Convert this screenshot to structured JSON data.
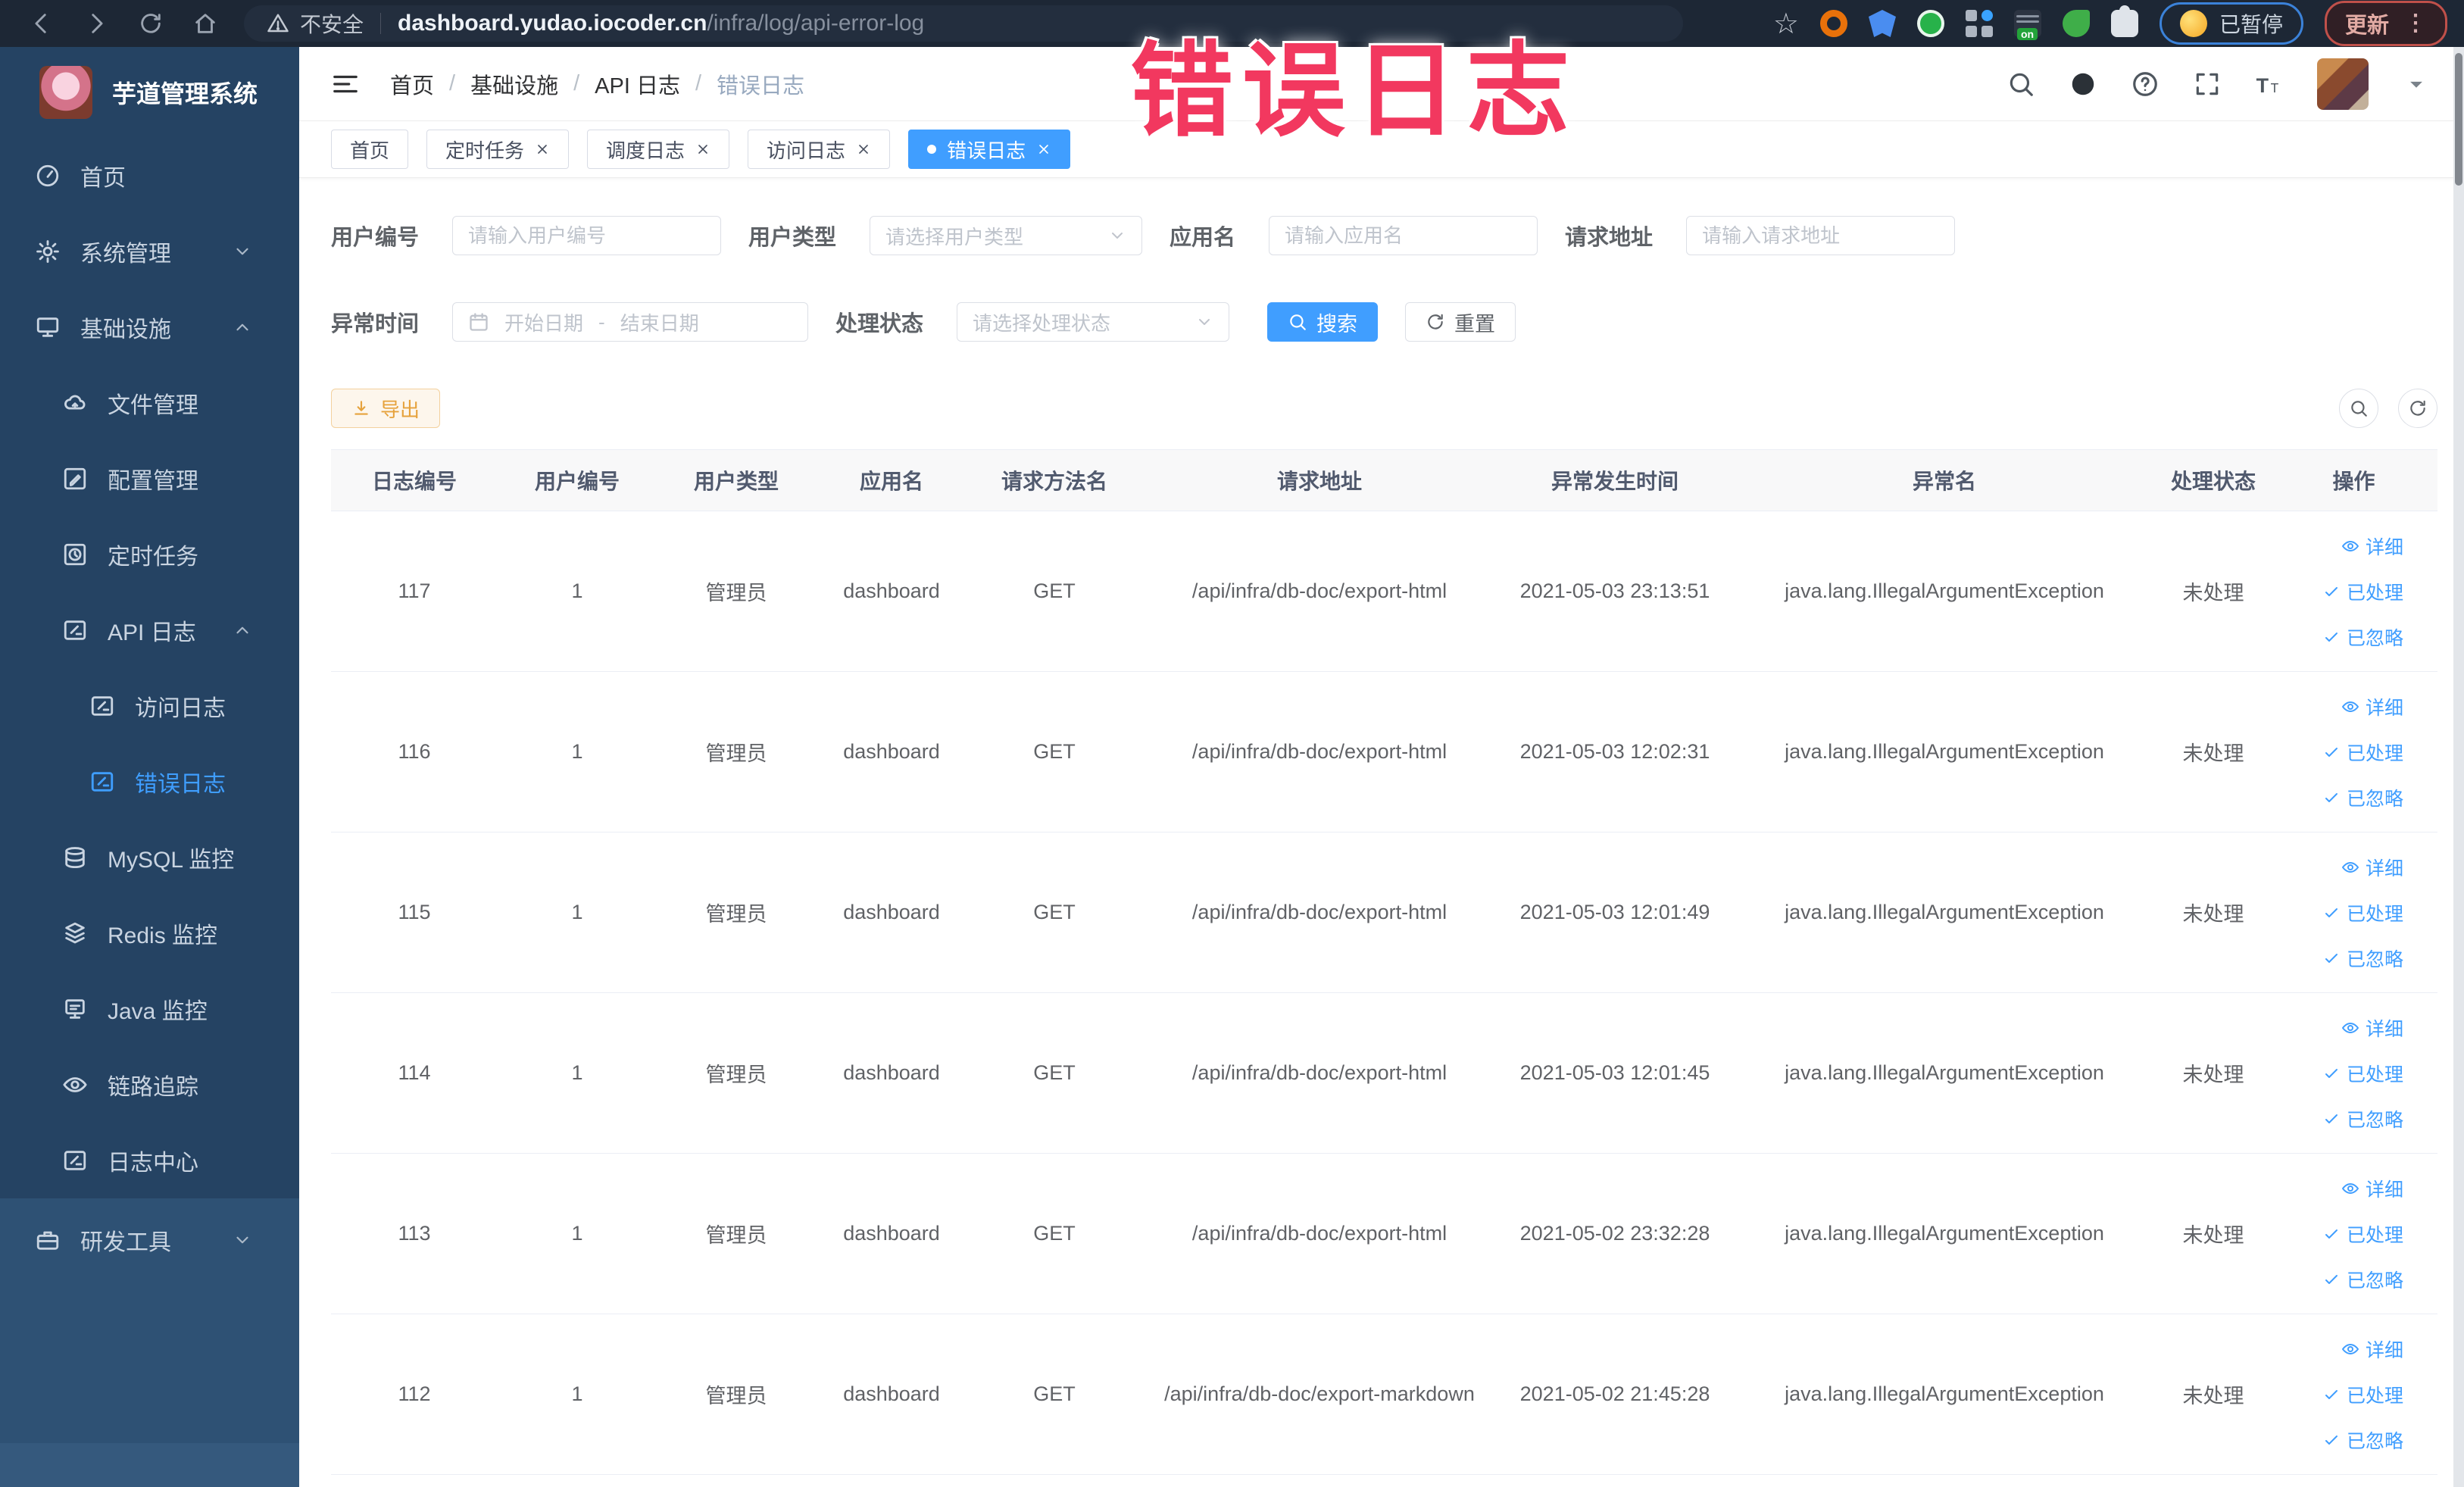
{
  "browser": {
    "security_label": "不安全",
    "url_domain": "dashboard.yudao.iocoder.cn",
    "url_path": "/infra/log/api-error-log",
    "paused_badge": "已暂停",
    "update_button": "更新"
  },
  "overlay": {
    "title": "错误日志"
  },
  "sidebar": {
    "logo_title": "芋道管理系统",
    "items": [
      {
        "id": "home",
        "label": "首页",
        "icon": "gauge",
        "level": 1
      },
      {
        "id": "system",
        "label": "系统管理",
        "icon": "gear",
        "level": 1,
        "chevron": "down"
      },
      {
        "id": "infra",
        "label": "基础设施",
        "icon": "monitor",
        "level": 1,
        "chevron": "up"
      },
      {
        "id": "file",
        "label": "文件管理",
        "icon": "cloud",
        "level": 2
      },
      {
        "id": "config",
        "label": "配置管理",
        "icon": "edit",
        "level": 2
      },
      {
        "id": "job",
        "label": "定时任务",
        "icon": "job",
        "level": 2
      },
      {
        "id": "api-log",
        "label": "API 日志",
        "icon": "logedit",
        "level": 2,
        "chevron": "up"
      },
      {
        "id": "access-log",
        "label": "访问日志",
        "icon": "logedit",
        "level": 3
      },
      {
        "id": "error-log",
        "label": "错误日志",
        "icon": "logedit",
        "level": 3,
        "active": true
      },
      {
        "id": "mysql",
        "label": "MySQL 监控",
        "icon": "mysql",
        "level": 2
      },
      {
        "id": "redis",
        "label": "Redis 监控",
        "icon": "redis",
        "level": 2
      },
      {
        "id": "java",
        "label": "Java 监控",
        "icon": "java",
        "level": 2
      },
      {
        "id": "trace",
        "label": "链路追踪",
        "icon": "eye",
        "level": 2
      },
      {
        "id": "log-center",
        "label": "日志中心",
        "icon": "logedit",
        "level": 2
      },
      {
        "id": "dev-tools",
        "label": "研发工具",
        "icon": "tools",
        "level": 1,
        "chevron": "down",
        "section": "light"
      }
    ]
  },
  "header": {
    "breadcrumb": [
      "首页",
      "基础设施",
      "API 日志",
      "错误日志"
    ]
  },
  "tabs": [
    {
      "label": "首页",
      "closable": false,
      "active": false
    },
    {
      "label": "定时任务",
      "closable": true,
      "active": false
    },
    {
      "label": "调度日志",
      "closable": true,
      "active": false
    },
    {
      "label": "访问日志",
      "closable": true,
      "active": false
    },
    {
      "label": "错误日志",
      "closable": true,
      "active": true
    }
  ],
  "filters": {
    "user_id": {
      "label": "用户编号",
      "placeholder": "请输入用户编号"
    },
    "user_type": {
      "label": "用户类型",
      "placeholder": "请选择用户类型"
    },
    "app_name": {
      "label": "应用名",
      "placeholder": "请输入应用名"
    },
    "request_url": {
      "label": "请求地址",
      "placeholder": "请输入请求地址"
    },
    "exception_time": {
      "label": "异常时间",
      "start_placeholder": "开始日期",
      "separator": "-",
      "end_placeholder": "结束日期"
    },
    "process_status": {
      "label": "处理状态",
      "placeholder": "请选择处理状态"
    },
    "search_button": "搜索",
    "reset_button": "重置"
  },
  "toolbar": {
    "export_button": "导出"
  },
  "table": {
    "columns": [
      "日志编号",
      "用户编号",
      "用户类型",
      "应用名",
      "请求方法名",
      "请求地址",
      "异常发生时间",
      "异常名",
      "处理状态",
      "操作"
    ],
    "rows": [
      [
        "117",
        "1",
        "管理员",
        "dashboard",
        "GET",
        "/api/infra/db-doc/export-html",
        "2021-05-03 23:13:51",
        "java.lang.IllegalArgumentException",
        "未处理"
      ],
      [
        "116",
        "1",
        "管理员",
        "dashboard",
        "GET",
        "/api/infra/db-doc/export-html",
        "2021-05-03 12:02:31",
        "java.lang.IllegalArgumentException",
        "未处理"
      ],
      [
        "115",
        "1",
        "管理员",
        "dashboard",
        "GET",
        "/api/infra/db-doc/export-html",
        "2021-05-03 12:01:49",
        "java.lang.IllegalArgumentException",
        "未处理"
      ],
      [
        "114",
        "1",
        "管理员",
        "dashboard",
        "GET",
        "/api/infra/db-doc/export-html",
        "2021-05-03 12:01:45",
        "java.lang.IllegalArgumentException",
        "未处理"
      ],
      [
        "113",
        "1",
        "管理员",
        "dashboard",
        "GET",
        "/api/infra/db-doc/export-html",
        "2021-05-02 23:32:28",
        "java.lang.IllegalArgumentException",
        "未处理"
      ],
      [
        "112",
        "1",
        "管理员",
        "dashboard",
        "GET",
        "/api/infra/db-doc/export-markdown",
        "2021-05-02 21:45:28",
        "java.lang.IllegalArgumentException",
        "未处理"
      ]
    ],
    "actions": [
      {
        "label": "详细",
        "icon": "eye"
      },
      {
        "label": "已处理",
        "icon": "check"
      },
      {
        "label": "已忽略",
        "icon": "check"
      }
    ]
  },
  "colors": {
    "accent": "#409eff",
    "warning": "#e6a23c",
    "overlay": "#f2385f",
    "sidebar": "#254363"
  }
}
